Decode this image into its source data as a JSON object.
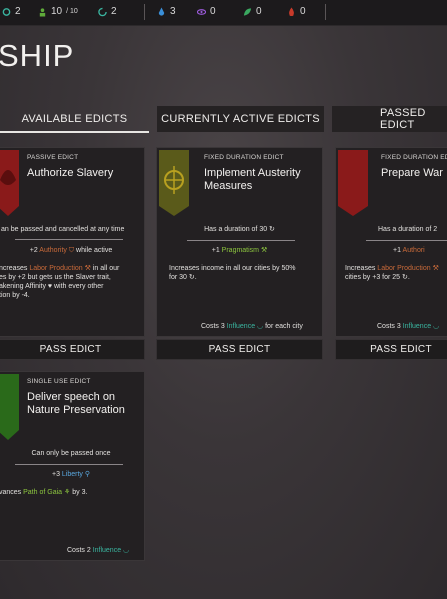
{
  "resources": [
    {
      "icon": "spiral-teal-icon",
      "value": "2"
    },
    {
      "icon": "people-green-icon",
      "value": "10",
      "max": "/ 10"
    },
    {
      "icon": "swirl-teal-icon",
      "value": "2"
    },
    {
      "icon": "drop-blue-icon",
      "value": "3"
    },
    {
      "icon": "eye-purple-icon",
      "value": "0"
    },
    {
      "icon": "leaf-green-icon",
      "value": "0"
    },
    {
      "icon": "flame-red-icon",
      "value": "0"
    }
  ],
  "page_title": "SHIP",
  "tabs": [
    {
      "label": "AVAILABLE EDICTS"
    },
    {
      "label": "CURRENTLY ACTIVE EDICTS"
    },
    {
      "label": "PASSED EDICT"
    }
  ],
  "cards": {
    "slavery": {
      "type": "PASSIVE EDICT",
      "name": "Authorize Slavery",
      "condition": "an be passed and cancelled at any time",
      "bonus_pre": "+2 ",
      "bonus_word": "Authority",
      "bonus_post": " while active",
      "d1_a": "ncreases ",
      "d1_b": "Labor Production",
      "d1_c": " in all our",
      "d2": "es by +2 but gets us the Slaver trait,",
      "d3": "akening Affinity ♥ with every other",
      "d4": "tion by -4.",
      "button": "PASS EDICT"
    },
    "austerity": {
      "type": "FIXED DURATION EDICT",
      "name": "Implement Austerity Measures",
      "condition": "Has a duration of 30",
      "bonus_pre": "+1 ",
      "bonus_word": "Pragmatism",
      "d1": "Increases income in all our cities by 50%",
      "d2": "for 30",
      "cost_pre": "Costs 3 ",
      "cost_word": "Influence",
      "cost_post": " for each city",
      "button": "PASS EDICT"
    },
    "war": {
      "type": "FIXED DURATION EDICT",
      "name": "Prepare War I",
      "condition": "Has a duration of 2",
      "bonus_pre": "+1 ",
      "bonus_word": "Authori",
      "d1_a": "Increases ",
      "d1_b": "Labor Production",
      "d2": "cities by +3 for 25",
      "cost_pre": "Costs 3 ",
      "cost_word": "Influence",
      "button": "PASS EDICT"
    },
    "nature": {
      "type": "SINGLE USE EDICT",
      "name": "Deliver speech on Nature Preservation",
      "condition": "Can only be passed once",
      "bonus_pre": "+3 ",
      "bonus_word": "Liberty",
      "d1_a": "vances ",
      "d1_b": "Path of Gaia",
      "d1_c": " by 3.",
      "cost_pre": "Costs 2 ",
      "cost_word": "Influence"
    }
  },
  "colors": {
    "authority": "#c96a3a",
    "pragmatism": "#8dc63f",
    "influence": "#3ab5a0",
    "liberty": "#5aa8e0"
  }
}
